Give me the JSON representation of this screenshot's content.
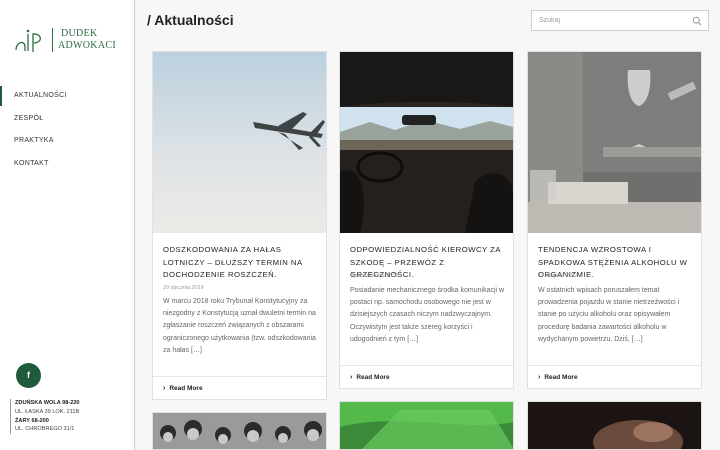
{
  "logo": {
    "mark": "aIP",
    "line1": "DUDEK",
    "line2": "ADWOKACI"
  },
  "nav": [
    {
      "label": "AKTUALNOŚCI"
    },
    {
      "label": "ZESPÓŁ"
    },
    {
      "label": "PRAKTYKA"
    },
    {
      "label": "KONTAKT"
    }
  ],
  "social": {
    "facebook_label": "f"
  },
  "addresses": [
    "ZDUŃSKA WOLA 98-220",
    "UL. ŁASKA 39 LOK. 211B",
    "ŻARY 68-200",
    "UL. CHROBREGO 31/1"
  ],
  "header": {
    "title": "/ Aktualności",
    "search_placeholder": "Szukaj"
  },
  "posts": [
    {
      "title": "ODSZKODOWANIA ZA HAŁAS LOTNICZY – DŁUŻSZY TERMIN NA DOCHODZENIE ROSZCZEŃ.",
      "date": "29 stycznia 2019",
      "excerpt": "W marcu 2018 roku Trybunał Konstytucyjny za niezgodny z Konstytucją uznał dwuletni termin na zgłaszanie roszczeń związanych z obszarami ograniczonego użytkowania (tzw. odszkodowania za hałas […]",
      "more": "Read More"
    },
    {
      "title": "ODPOWIEDZIALNOŚĆ KIEROWCY ZA SZKODĘ – PRZEWÓZ Z GRZECZNOŚCI.",
      "date": "4 października 2018",
      "excerpt": "Posiadanie mechanicznego środka komunikacji w postaci np. samochodu osobowego nie jest w dzisiejszych czasach niczym nadzwyczajnym. Oczywistym jest także szereg korzyści i udogodnień z tym […]",
      "more": "Read More"
    },
    {
      "title": "TENDENCJA WZROSTOWA I SPADKOWA STĘŻENIA ALKOHOLU W ORGANIZMIE.",
      "date": "17 sierpnia 2017",
      "excerpt": "W ostatnich wpisach poruszałem temat prowadzenia pojazdu w stanie nietrzeźwości i stanie po użyciu alkoholu oraz opisywałem procedurę badania zawartości alkoholu w wydychanym powietrzu. Dziś, […]",
      "more": "Read More"
    }
  ],
  "icons": {
    "search": "search-icon",
    "facebook": "facebook-icon",
    "chevron": "chevron-right-icon"
  },
  "colors": {
    "brand": "#1f5b3b",
    "logo": "#2e6b45"
  }
}
